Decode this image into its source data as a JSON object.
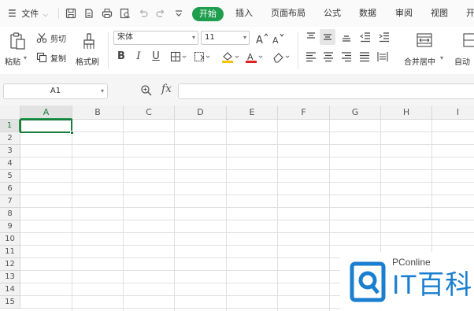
{
  "menubar": {
    "menu_label": "文件",
    "tabs": [
      "开始",
      "插入",
      "页面布局",
      "公式",
      "数据",
      "审阅",
      "视图",
      "开"
    ],
    "active_tab": "开始"
  },
  "ribbon": {
    "paste_label": "粘贴",
    "cut_label": "剪切",
    "copy_label": "复制",
    "format_painter_label": "格式刷",
    "font_name": "宋体",
    "font_size": "11",
    "bold": "B",
    "italic": "I",
    "underline": "U",
    "merge_label": "合并居中",
    "autowrap_label": "自动"
  },
  "formula_bar": {
    "name_box": "A1",
    "fx_label": "fx",
    "formula_value": ""
  },
  "sheet": {
    "columns": [
      "A",
      "B",
      "C",
      "D",
      "E",
      "F",
      "G",
      "H",
      "I"
    ],
    "rows": [
      "1",
      "2",
      "3",
      "4",
      "5",
      "6",
      "7",
      "8",
      "9",
      "10",
      "11",
      "12",
      "13",
      "14",
      "15"
    ],
    "active_cell": "A1"
  },
  "watermark": {
    "brand_small": "PConline",
    "brand_big": "IT百科"
  },
  "colors": {
    "accent": "#1e9d4d",
    "active_cell": "#1e7d3d",
    "watermark_blue": "#1a7fd0"
  }
}
